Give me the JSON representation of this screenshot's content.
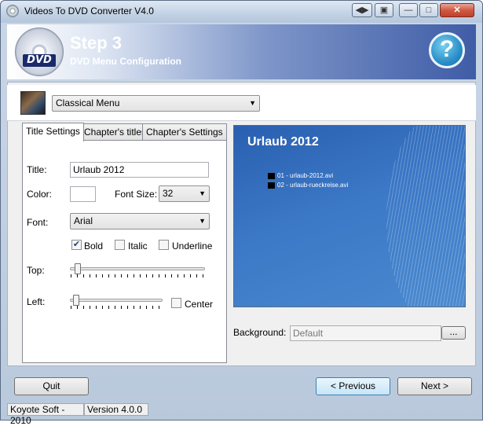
{
  "window": {
    "title": "Videos To DVD Converter V4.0"
  },
  "header": {
    "step_title": "Step 3",
    "step_subtitle": "DVD Menu Configuration",
    "help_glyph": "?",
    "dvd_logo": "DVD"
  },
  "menu_style": {
    "selected": "Classical Menu"
  },
  "tabs": [
    {
      "label": "Title Settings",
      "active": true
    },
    {
      "label": "Chapter's titles",
      "active": false
    },
    {
      "label": "Chapter's Settings",
      "active": false
    }
  ],
  "title_settings": {
    "title_label": "Title:",
    "title_value": "Urlaub 2012",
    "color_label": "Color:",
    "color_value": "#ffffff",
    "font_size_label": "Font Size:",
    "font_size_value": "32",
    "font_label": "Font:",
    "font_value": "Arial",
    "bold_label": "Bold",
    "bold_checked": true,
    "italic_label": "Italic",
    "italic_checked": false,
    "underline_label": "Underline",
    "underline_checked": false,
    "top_label": "Top:",
    "top_level": 0.03,
    "left_label": "Left:",
    "left_level": 0.03,
    "center_label": "Center",
    "center_checked": false
  },
  "preview": {
    "title": "Urlaub 2012",
    "chapters": [
      "01 - urlaub-2012.avi",
      "02 - urlaub-rueckreise.avi"
    ]
  },
  "background": {
    "label": "Background:",
    "value": "Default",
    "browse_label": "..."
  },
  "buttons": {
    "quit": "Quit",
    "previous": "< Previous",
    "next": "Next >"
  },
  "status": {
    "company": "Koyote Soft - 2010",
    "version": "Version 4.0.0"
  },
  "icons": {
    "titlebar_extra": "arrows-icon",
    "restore": "restore-icon",
    "minimize": "minimize-icon",
    "maximize": "maximize-icon",
    "close": "close-icon"
  },
  "colors": {
    "header_blue": "#3f5ca6",
    "preview_blue": "#3b78c6",
    "close_red": "#c0402a"
  }
}
